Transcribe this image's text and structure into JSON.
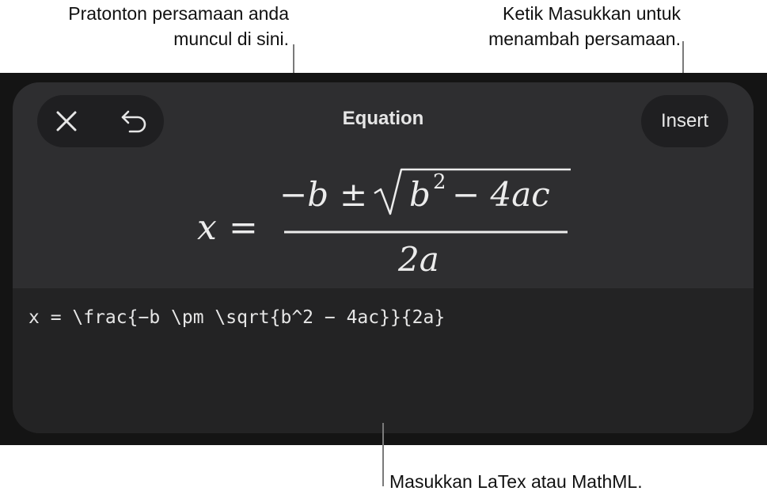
{
  "callouts": {
    "preview_line1": "Pratonton persamaan anda",
    "preview_line2": "muncul di sini.",
    "insert_line1": "Ketik Masukkan untuk",
    "insert_line2": "menambah persamaan.",
    "latex": "Masukkan LaTex atau MathML."
  },
  "toolbar": {
    "close_icon": "close-icon",
    "undo_icon": "undo-icon",
    "title": "Equation",
    "insert_label": "Insert"
  },
  "preview": {
    "lhs": "x",
    "equals": "=",
    "num_minus_b": "−b",
    "num_pm": "±",
    "radicand_b": "b",
    "radicand_exp": "2",
    "radicand_rest": "− 4ac",
    "denominator": "2a"
  },
  "editor": {
    "latex": "x = \\frac{−b \\pm \\sqrt{b^2 − 4ac}}{2a}"
  },
  "colors": {
    "screen_bg": "#141414",
    "panel_bg": "#232324",
    "preview_bg": "#2e2e30",
    "button_bg": "#1f1f21",
    "text": "#e6e6e6"
  }
}
